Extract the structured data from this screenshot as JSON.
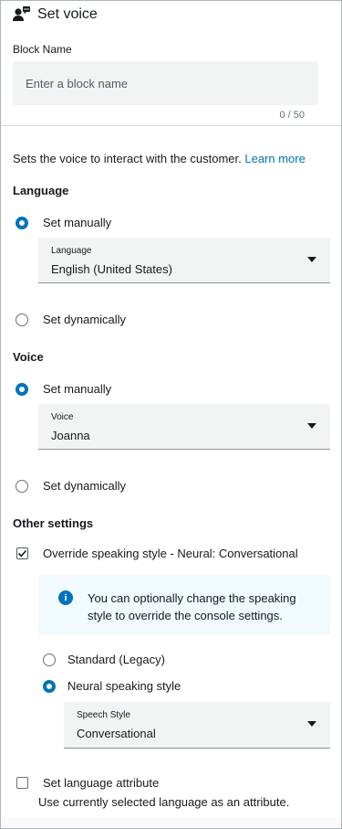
{
  "header": {
    "title": "Set voice",
    "icon": "contact-voice-icon"
  },
  "block_name": {
    "label": "Block Name",
    "placeholder": "Enter a block name",
    "value": "",
    "counter": "0 / 50"
  },
  "description": {
    "text": "Sets the voice to interact with the customer.",
    "link": "Learn more"
  },
  "language": {
    "title": "Language",
    "manual_label": "Set manually",
    "select_label": "Language",
    "select_value": "English (United States)",
    "dynamic_label": "Set dynamically",
    "selected": "manual"
  },
  "voice": {
    "title": "Voice",
    "manual_label": "Set manually",
    "select_label": "Voice",
    "select_value": "Joanna",
    "dynamic_label": "Set dynamically",
    "selected": "manual"
  },
  "other": {
    "title": "Other settings",
    "override_label": "Override speaking style - Neural: Conversational",
    "override_checked": true,
    "info_text": "You can optionally change the speaking style to override the console settings.",
    "standard_label": "Standard (Legacy)",
    "neural_label": "Neural speaking style",
    "speaking_selected": "neural",
    "speech_select_label": "Speech Style",
    "speech_select_value": "Conversational",
    "lang_attr_label": "Set language attribute",
    "lang_attr_checked": false,
    "lang_attr_desc": "Use currently selected language as an attribute."
  },
  "colors": {
    "accent": "#0073bb",
    "info_bg": "#f1faff",
    "input_bg": "#f2f3f3"
  }
}
